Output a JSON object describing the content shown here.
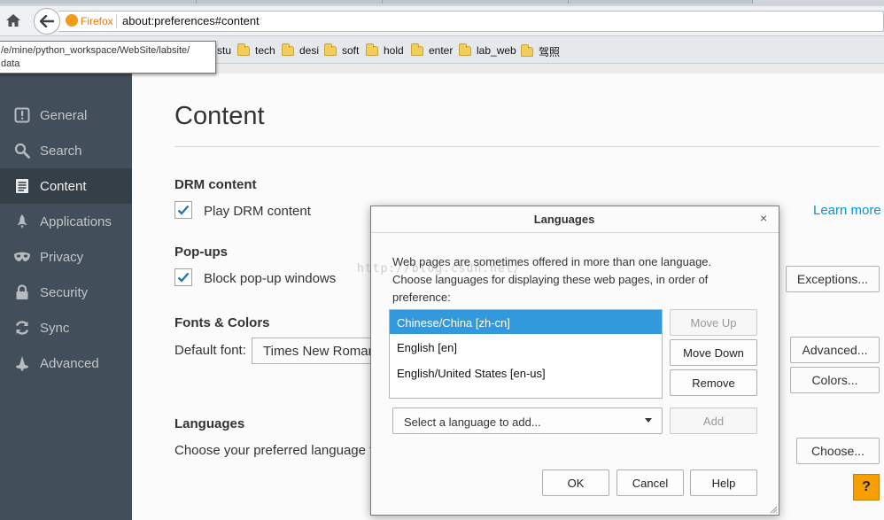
{
  "browser": {
    "brand_label": "Firefox",
    "url": "about:preferences#content",
    "bookmarks": [
      "stu",
      "tech",
      "desi",
      "soft",
      "hold",
      "enter",
      "lab_web",
      "驾照"
    ],
    "tooltip_lines": [
      "/e/mine/python_workspace/WebSite/labsite/",
      "data"
    ]
  },
  "sidebar": {
    "items": [
      {
        "label": "General",
        "icon": "general-icon"
      },
      {
        "label": "Search",
        "icon": "search-icon"
      },
      {
        "label": "Content",
        "icon": "document-icon",
        "active": true
      },
      {
        "label": "Applications",
        "icon": "rocket-icon"
      },
      {
        "label": "Privacy",
        "icon": "mask-icon"
      },
      {
        "label": "Security",
        "icon": "padlock-icon"
      },
      {
        "label": "Sync",
        "icon": "sync-icon"
      },
      {
        "label": "Advanced",
        "icon": "wizard-icon"
      }
    ]
  },
  "main": {
    "title": "Content",
    "drm": {
      "heading": "DRM content",
      "checkbox_label": "Play DRM content",
      "checked": true,
      "learn_more": "Learn more"
    },
    "popups": {
      "heading": "Pop-ups",
      "checkbox_label": "Block pop-up windows",
      "checked": true,
      "exceptions": "Exceptions..."
    },
    "fonts": {
      "heading": "Fonts & Colors",
      "default_font_label": "Default font:",
      "default_font_value": "Times New Roman",
      "advanced": "Advanced...",
      "colors": "Colors..."
    },
    "languages": {
      "heading": "Languages",
      "description": "Choose your preferred language f",
      "choose": "Choose..."
    }
  },
  "dialog": {
    "title": "Languages",
    "close": "×",
    "description": "Web pages are sometimes offered in more than one language. Choose languages for displaying these web pages, in order of preference:",
    "languages": [
      {
        "label": "Chinese/China  [zh-cn]",
        "selected": true
      },
      {
        "label": "English  [en]",
        "selected": false
      },
      {
        "label": "English/United States  [en-us]",
        "selected": false
      }
    ],
    "move_up": "Move Up",
    "move_down": "Move Down",
    "remove": "Remove",
    "select_placeholder": "Select a language to add...",
    "add": "Add",
    "ok": "OK",
    "cancel": "Cancel",
    "help": "Help"
  },
  "watermark": "http://blog.csdn.net/",
  "help_badge": "?",
  "colors": {
    "sidebar_bg": "#424f5a",
    "sidebar_active": "#343f48",
    "selection": "#3399dd",
    "link": "#0095dd",
    "help_badge": "#f5a000"
  }
}
